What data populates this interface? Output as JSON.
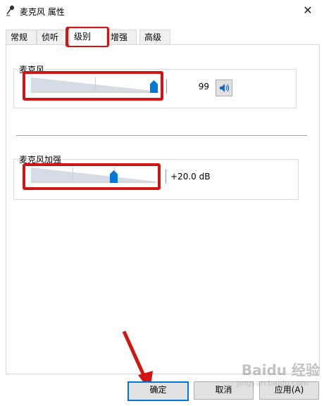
{
  "window": {
    "title": "麦克风 属性",
    "close_symbol": "✕"
  },
  "tabs": [
    {
      "label": "常规",
      "active": false
    },
    {
      "label": "侦听",
      "active": false
    },
    {
      "label": "级别",
      "active": true
    },
    {
      "label": "增强",
      "active": false
    },
    {
      "label": "高级",
      "active": false
    }
  ],
  "microphone": {
    "label": "麦克风",
    "value": "99",
    "level_percent": 99,
    "speaker_icon": "speaker-icon"
  },
  "boost": {
    "label": "麦克风加强",
    "value": "+20.0 dB",
    "level_fraction": 0.67
  },
  "buttons": {
    "ok": "确定",
    "cancel": "取消",
    "apply": "应用(A)"
  },
  "watermark": {
    "main": "Baidu 经验",
    "sub": "jingyan.baidu.com"
  },
  "colors": {
    "accent": "#0078d7",
    "annotation": "#d11414"
  }
}
